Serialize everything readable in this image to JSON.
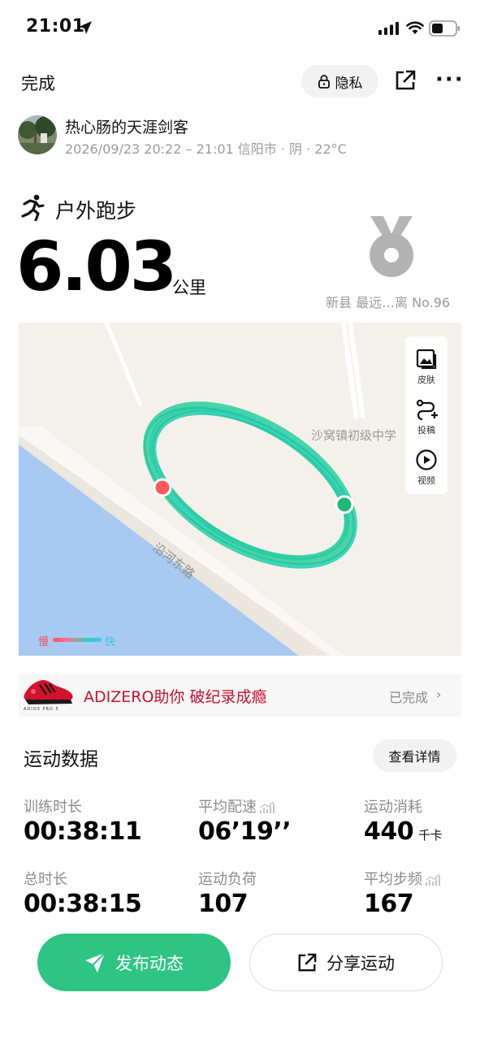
{
  "status_bar": {
    "time": "21:01"
  },
  "header": {
    "done_label": "完成",
    "privacy_label": "隐私"
  },
  "user": {
    "name": "热心肠的天涯剑客",
    "meta": "2026/09/23 20:22 – 21:01 信阳市 · 阴 · 22°C"
  },
  "activity": {
    "type": "户外跑步",
    "distance": "6.03",
    "distance_unit": "公里",
    "medal_text": "新县 最远…离 No.96"
  },
  "map": {
    "tools": [
      {
        "label": "皮肤",
        "icon": "image-icon"
      },
      {
        "label": "投稿",
        "icon": "route-add-icon"
      },
      {
        "label": "视频",
        "icon": "play-icon"
      }
    ],
    "school_label": "沙窝镇初级中学",
    "road_label": "沿河东路",
    "legend_slow": "慢",
    "legend_fast": "快",
    "colors": {
      "water": "#a7c9f2",
      "route": "#2ccf9a",
      "start": "#ff5a5f",
      "end": "#1fb878"
    }
  },
  "ad": {
    "text": "ADIZERO助你 破纪录成瘾",
    "brand": "ADIOS PRO 5",
    "status": "已完成"
  },
  "stats": {
    "title": "运动数据",
    "details_label": "查看详情",
    "items": [
      {
        "label": "训练时长",
        "value": "00:38:11",
        "unit": ""
      },
      {
        "label": "平均配速",
        "value": "06’19’’",
        "unit": ""
      },
      {
        "label": "运动消耗",
        "value": "440",
        "unit": "千卡"
      },
      {
        "label": "总时长",
        "value": "00:38:15",
        "unit": ""
      },
      {
        "label": "运动负荷",
        "value": "107",
        "unit": ""
      },
      {
        "label": "平均步频",
        "value": "167",
        "unit": ""
      }
    ]
  },
  "bottom": {
    "publish_label": "发布动态",
    "share_label": "分享运动"
  },
  "colors": {
    "accent": "#2ec584",
    "ad_red": "#c8102e",
    "muted": "#8c8c8c"
  }
}
